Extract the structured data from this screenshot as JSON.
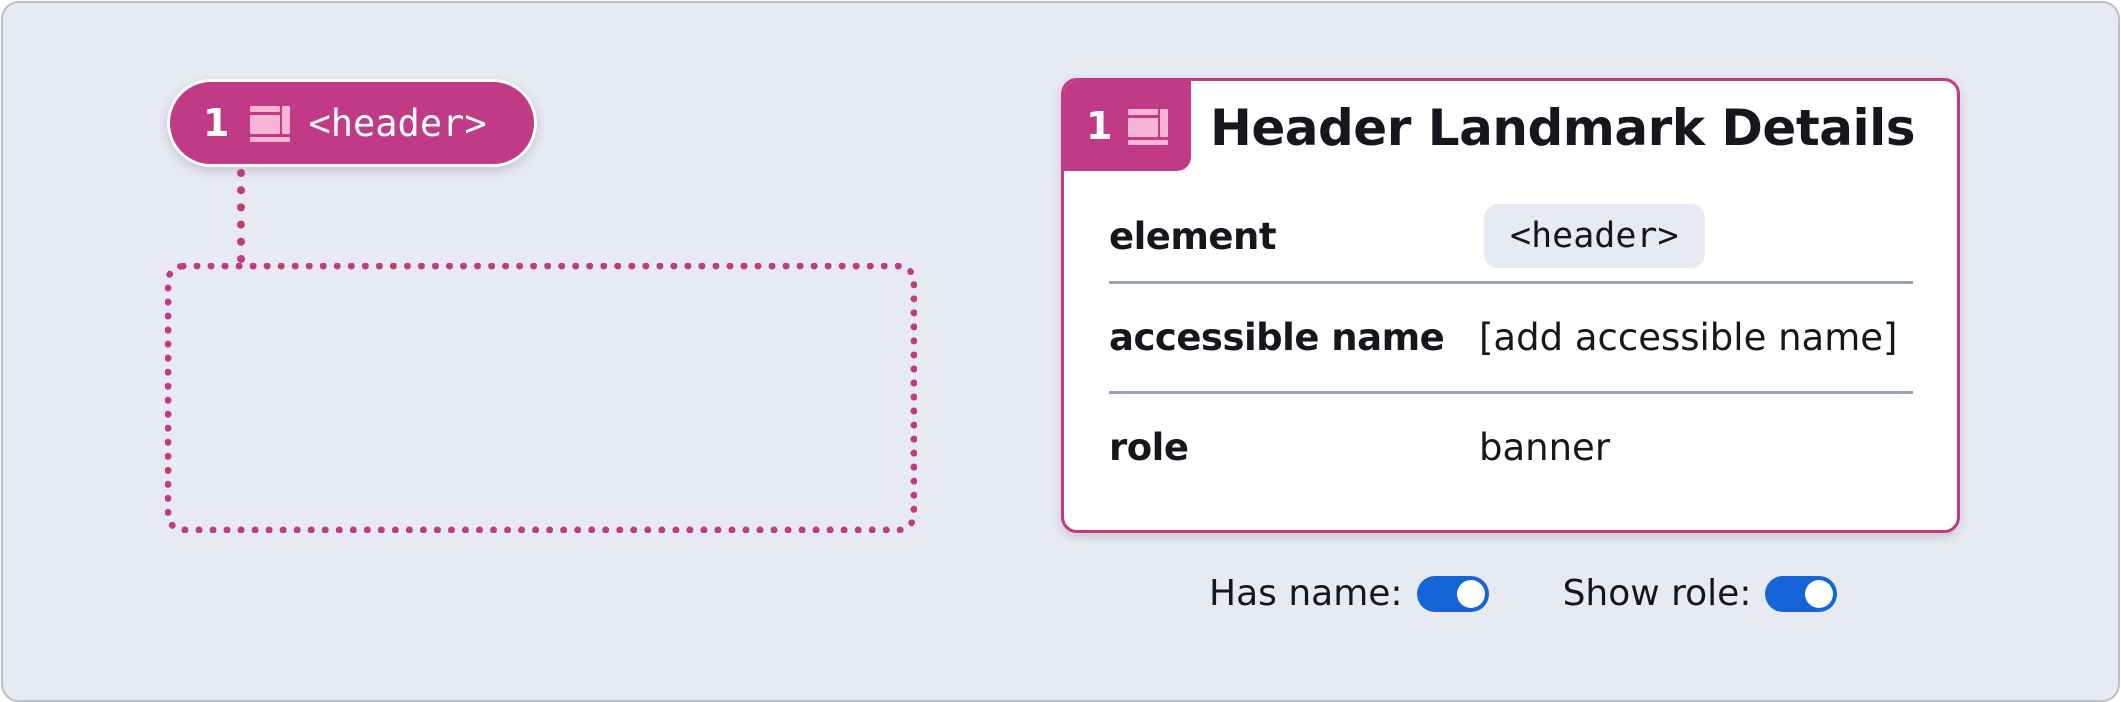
{
  "landmark": {
    "number": "1",
    "icon": "landmark-header-icon",
    "tag_text": "<header>"
  },
  "details": {
    "number": "1",
    "icon": "landmark-header-icon",
    "title": "Header Landmark Details",
    "rows": [
      {
        "label": "element",
        "value": "<header>"
      },
      {
        "label": "accessible name",
        "value": "[add accessible name]"
      },
      {
        "label": "role",
        "value": "banner"
      }
    ]
  },
  "toggles": [
    {
      "label": "Has name:",
      "on": true
    },
    {
      "label": "Show role:",
      "on": true
    }
  ],
  "colors": {
    "accent": "#c03a86",
    "toggle_on": "#1565d8",
    "background": "#e7eaf2"
  }
}
